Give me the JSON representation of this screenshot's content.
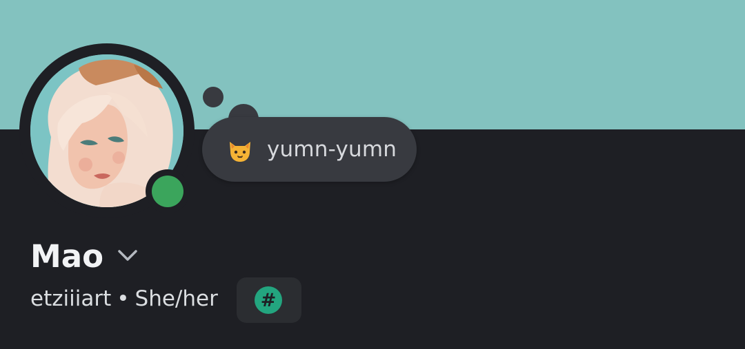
{
  "profile": {
    "display_name": "Mao",
    "username": "etziiiart",
    "separator": "•",
    "pronouns": "She/her",
    "status": "online",
    "avatar_icon": "illustrated-avatar"
  },
  "custom_status": {
    "emoji_icon": "cat-face-emoji",
    "text": "yumn-yumn"
  },
  "badge": {
    "glyph": "#",
    "icon": "hashtag-icon"
  },
  "colors": {
    "banner": "#83c2bf",
    "background": "#1e1f24",
    "bubble": "#383a40",
    "online": "#3ba55c",
    "badge_accent": "#23a57f"
  }
}
